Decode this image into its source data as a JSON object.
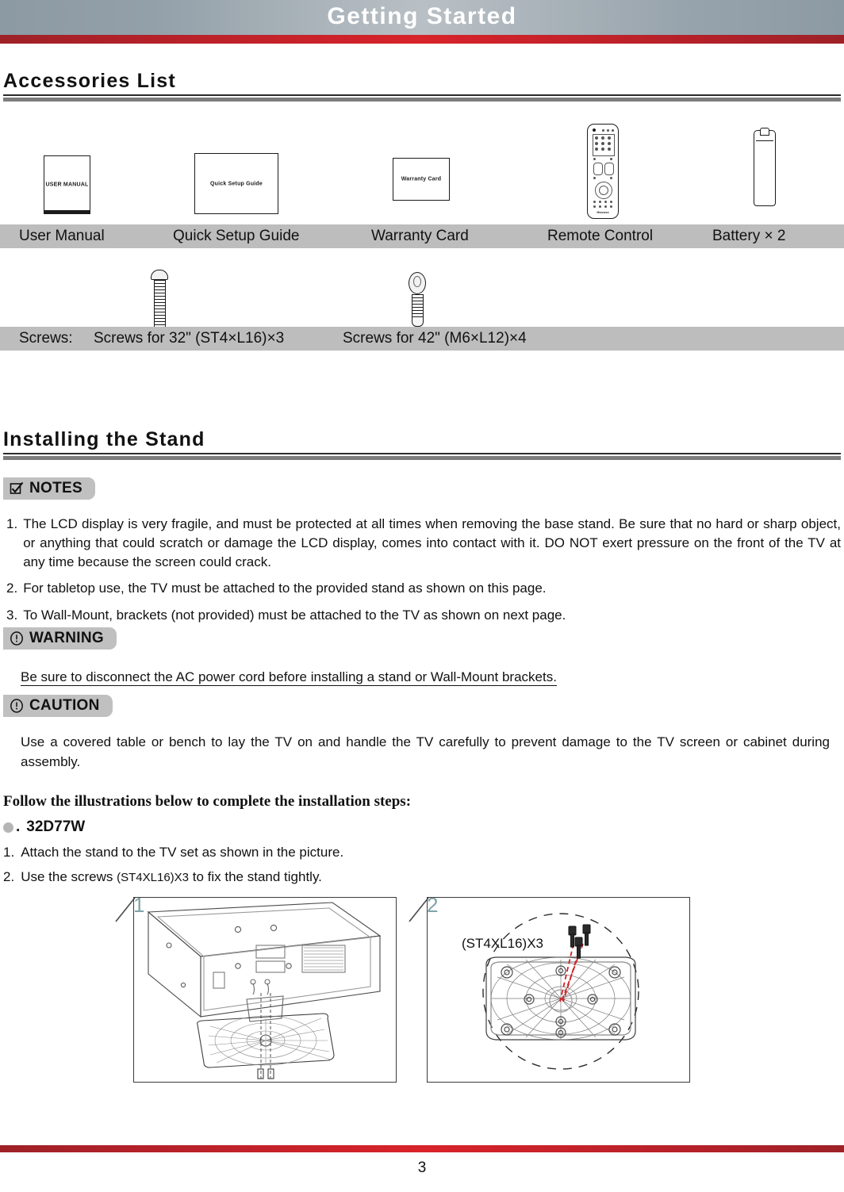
{
  "banner": {
    "title": "Getting Started",
    "bg_color": "#8c9aa4",
    "accent_color": "#c8232b"
  },
  "sections": {
    "accessories": {
      "title": "Accessories List"
    },
    "stand": {
      "title": "Installing the Stand"
    }
  },
  "accessories": {
    "figure_labels": {
      "user_manual": "USER MANUAL",
      "quick_setup": "Quick Setup Guide",
      "warranty": "Warranty Card",
      "remote_brand": "Hisense"
    },
    "row1": [
      {
        "label": "User Manual"
      },
      {
        "label": "Quick Setup Guide"
      },
      {
        "label": "Warranty Card"
      },
      {
        "label": "Remote Control"
      },
      {
        "label": "Battery × 2"
      }
    ],
    "row2": [
      {
        "label": "Screws:"
      },
      {
        "label": "Screws for 32\" (ST4×L16)×3"
      },
      {
        "label": "Screws for 42\" (M6×L12)×4"
      }
    ]
  },
  "notes": {
    "badge_label": "NOTES",
    "badge_icon": "checkbox-check-icon",
    "items": [
      {
        "num": "1.",
        "text": "The LCD display is very fragile, and must be protected at all times when removing the base stand. Be sure that no hard or sharp object, or anything that could scratch or damage the LCD display, comes into contact with it. DO NOT exert pressure on the front of the TV at any time because the screen could crack."
      },
      {
        "num": "2.",
        "text": "For tabletop use, the TV must be attached to the provided stand as shown on this page."
      },
      {
        "num": "3.",
        "text": "To Wall-Mount, brackets (not provided) must be attached to the TV as shown on next page."
      }
    ]
  },
  "warning": {
    "badge_label": "WARNING",
    "badge_icon": "exclamation-circle-icon",
    "text": "Be sure to disconnect the AC power cord before installing a stand or Wall-Mount brackets."
  },
  "caution": {
    "badge_label": "CAUTION",
    "badge_icon": "exclamation-circle-icon",
    "text": "Use a covered table or bench to lay the TV on and handle the TV carefully to prevent damage to the TV screen or cabinet during assembly."
  },
  "install": {
    "heading": "Follow the illustrations below to complete the installation steps:",
    "model_prefix": ".",
    "model": "32D77W",
    "steps": [
      {
        "num": "1.",
        "text": "Attach the stand to the TV set as shown in the picture.",
        "code": ""
      },
      {
        "num": "2.",
        "text_before": "Use the screws ",
        "code": "(ST4XL16)X3",
        "text_after": " to fix the stand tightly."
      }
    ],
    "figures": [
      {
        "number": "1",
        "caption": ""
      },
      {
        "number": "2",
        "caption": "(ST4XL16)X3"
      }
    ]
  },
  "footer": {
    "page_number": "3"
  }
}
